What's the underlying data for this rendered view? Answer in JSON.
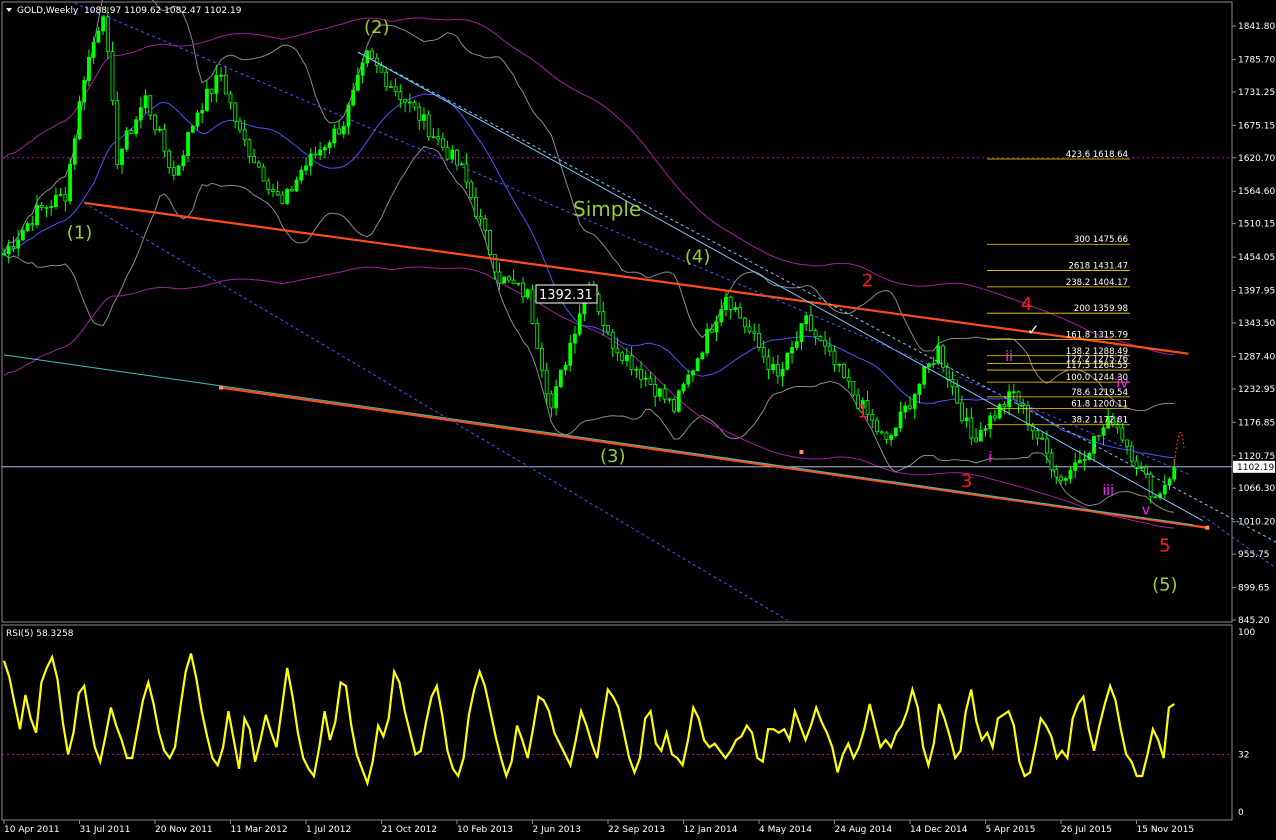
{
  "header": {
    "symbol": "GOLD,Weekly",
    "ohlc": "1088.97 1109.62 1082.47 1102.19"
  },
  "colors": {
    "background": "#000000",
    "candles": "#00ff00",
    "rsi_line": "#ffff00",
    "trendline": "#ff4d1a",
    "channel_line": "#7ec8ff",
    "envelope": "#a020a0",
    "band": "#8a8a8a",
    "wave_green": "#9acd32",
    "wave_red": "#ff1a1a",
    "wave_magenta": "#ff22ff",
    "fib": "#ffd700"
  },
  "chart_data": [
    {
      "type": "candlestick",
      "ylim": [
        845.2,
        1870
      ],
      "y_ticks": [
        "1841.80",
        "1785.70",
        "1731.25",
        "1675.15",
        "1620.70",
        "1564.60",
        "1510.15",
        "1454.05",
        "1397.95",
        "1343.50",
        "1287.40",
        "1232.95",
        "1176.85",
        "1120.75",
        "1066.30",
        "1010.20",
        "955.75",
        "899.65",
        "845.20"
      ],
      "x_ticks": [
        "10 Apr 2011",
        "31 Jul 2011",
        "20 Nov 2011",
        "11 Mar 2012",
        "1 Jul 2012",
        "21 Oct 2012",
        "10 Feb 2013",
        "2 Jun 2013",
        "22 Sep 2013",
        "12 Jan 2014",
        "4 May 2014",
        "24 Aug 2014",
        "14 Dec 2014",
        "5 Apr 2015",
        "26 Jul 2015",
        "15 Nov 2015"
      ],
      "price_path": [
        {
          "date": "10 Apr 2011",
          "price": 1460
        },
        {
          "date": "29 May 2011",
          "price": 1530
        },
        {
          "date": "10 Jul 2011",
          "price": 1560
        },
        {
          "date": "7 Aug 2011",
          "price": 1760
        },
        {
          "date": "4 Sep 2011",
          "price": 1870
        },
        {
          "date": "25 Sep 2011",
          "price": 1620
        },
        {
          "date": "6 Nov 2011",
          "price": 1720
        },
        {
          "date": "18 Dec 2011",
          "price": 1590
        },
        {
          "date": "22 Jan 2012",
          "price": 1700
        },
        {
          "date": "26 Feb 2012",
          "price": 1760
        },
        {
          "date": "25 Mar 2012",
          "price": 1660
        },
        {
          "date": "27 May 2012",
          "price": 1540
        },
        {
          "date": "24 Jun 2012",
          "price": 1600
        },
        {
          "date": "26 Aug 2012",
          "price": 1680
        },
        {
          "date": "30 Sep 2012",
          "price": 1790
        },
        {
          "date": "16 Dec 2012",
          "price": 1690
        },
        {
          "date": "17 Feb 2013",
          "price": 1600
        },
        {
          "date": "14 Apr 2013",
          "price": 1420
        },
        {
          "date": "26 May 2013",
          "price": 1390
        },
        {
          "date": "30 Jun 2013",
          "price": 1200
        },
        {
          "date": "25 Aug 2013",
          "price": 1420
        },
        {
          "date": "22 Sep 2013",
          "price": 1320
        },
        {
          "date": "29 Dec 2013",
          "price": 1200
        },
        {
          "date": "16 Mar 2014",
          "price": 1392.31
        },
        {
          "date": "1 Jun 2014",
          "price": 1250
        },
        {
          "date": "13 Jul 2014",
          "price": 1345
        },
        {
          "date": "9 Nov 2014",
          "price": 1140
        },
        {
          "date": "25 Jan 2015",
          "price": 1300
        },
        {
          "date": "15 Mar 2015",
          "price": 1150
        },
        {
          "date": "17 May 2015",
          "price": 1225
        },
        {
          "date": "26 Jul 2015",
          "price": 1080
        },
        {
          "date": "11 Oct 2015",
          "price": 1185
        },
        {
          "date": "13 Dec 2015",
          "price": 1050
        },
        {
          "date": "10 Jan 2016",
          "price": 1102.19
        }
      ],
      "current_price": "1102.19",
      "peak_label": "1392.31",
      "title_text": "Simple",
      "wave_labels": [
        {
          "text": "(1)",
          "color": "wave_green"
        },
        {
          "text": "(2)",
          "color": "wave_green"
        },
        {
          "text": "(3)",
          "color": "wave_green"
        },
        {
          "text": "(4)",
          "color": "wave_green"
        },
        {
          "text": "(5)",
          "color": "wave_green"
        },
        {
          "text": "1",
          "color": "wave_red"
        },
        {
          "text": "2",
          "color": "wave_red"
        },
        {
          "text": "3",
          "color": "wave_red"
        },
        {
          "text": "4",
          "color": "wave_red"
        },
        {
          "text": "5",
          "color": "wave_red"
        },
        {
          "text": "i",
          "color": "wave_magenta"
        },
        {
          "text": "ii",
          "color": "wave_magenta"
        },
        {
          "text": "iii",
          "color": "wave_magenta"
        },
        {
          "text": "iv",
          "color": "wave_magenta"
        },
        {
          "text": "v",
          "color": "wave_magenta"
        }
      ],
      "fib_levels": [
        {
          "label": "423.6 1618.64",
          "price": 1618.64
        },
        {
          "label": "300 1475.66",
          "price": 1475.66
        },
        {
          "label": "2618 1431.47",
          "price": 1431.47
        },
        {
          "label": "238.2 1404.17",
          "price": 1404.17
        },
        {
          "label": "200 1359.98",
          "price": 1359.98
        },
        {
          "label": "161.8 1315.79",
          "price": 1315.79
        },
        {
          "label": "138.2 1288.49",
          "price": 1288.49
        },
        {
          "label": "127.2 1275.76",
          "price": 1275.76
        },
        {
          "label": "117.5 1264.55",
          "price": 1264.55
        },
        {
          "label": "100.0 1244.30",
          "price": 1244.3
        },
        {
          "label": "78.6 1219.54",
          "price": 1219.54
        },
        {
          "label": "61.8 1200.11",
          "price": 1200.11
        },
        {
          "label": "38.2 1172.81",
          "price": 1172.81
        }
      ],
      "check_mark": "✓"
    },
    {
      "type": "line",
      "title": "RSI(5) 58.3258",
      "ylim": [
        0,
        100
      ],
      "y_ticks": [
        "100",
        "32",
        "0"
      ],
      "level": 32,
      "values": [
        84,
        75,
        60,
        46,
        65,
        52,
        44,
        72,
        80,
        86,
        74,
        50,
        32,
        44,
        66,
        70,
        52,
        36,
        28,
        42,
        58,
        48,
        40,
        30,
        30,
        46,
        62,
        72,
        60,
        44,
        34,
        30,
        36,
        58,
        78,
        88,
        74,
        56,
        42,
        30,
        26,
        36,
        56,
        40,
        24,
        52,
        46,
        28,
        40,
        54,
        44,
        36,
        58,
        80,
        64,
        44,
        30,
        24,
        20,
        36,
        56,
        40,
        50,
        72,
        70,
        48,
        32,
        24,
        16,
        28,
        48,
        42,
        52,
        78,
        72,
        56,
        44,
        32,
        34,
        50,
        64,
        70,
        54,
        34,
        24,
        20,
        30,
        54,
        68,
        78,
        70,
        56,
        42,
        30,
        20,
        28,
        48,
        40,
        30,
        46,
        64,
        62,
        56,
        44,
        38,
        32,
        26,
        40,
        56,
        48,
        38,
        30,
        50,
        68,
        64,
        58,
        44,
        30,
        22,
        30,
        52,
        56,
        38,
        34,
        44,
        32,
        30,
        26,
        40,
        58,
        52,
        40,
        36,
        38,
        34,
        30,
        34,
        40,
        42,
        48,
        44,
        30,
        28,
        46,
        46,
        44,
        46,
        40,
        56,
        48,
        40,
        48,
        58,
        50,
        44,
        36,
        22,
        32,
        38,
        30,
        36,
        46,
        60,
        48,
        36,
        40,
        36,
        44,
        48,
        56,
        68,
        58,
        36,
        26,
        38,
        60,
        52,
        42,
        30,
        34,
        56,
        68,
        50,
        40,
        44,
        36,
        52,
        54,
        56,
        48,
        28,
        20,
        22,
        36,
        52,
        48,
        42,
        30,
        34,
        30,
        52,
        60,
        64,
        46,
        34,
        48,
        60,
        70,
        62,
        46,
        32,
        28,
        20,
        20,
        32,
        46,
        40,
        30,
        58,
        60
      ],
      "current": 58.3258
    }
  ]
}
